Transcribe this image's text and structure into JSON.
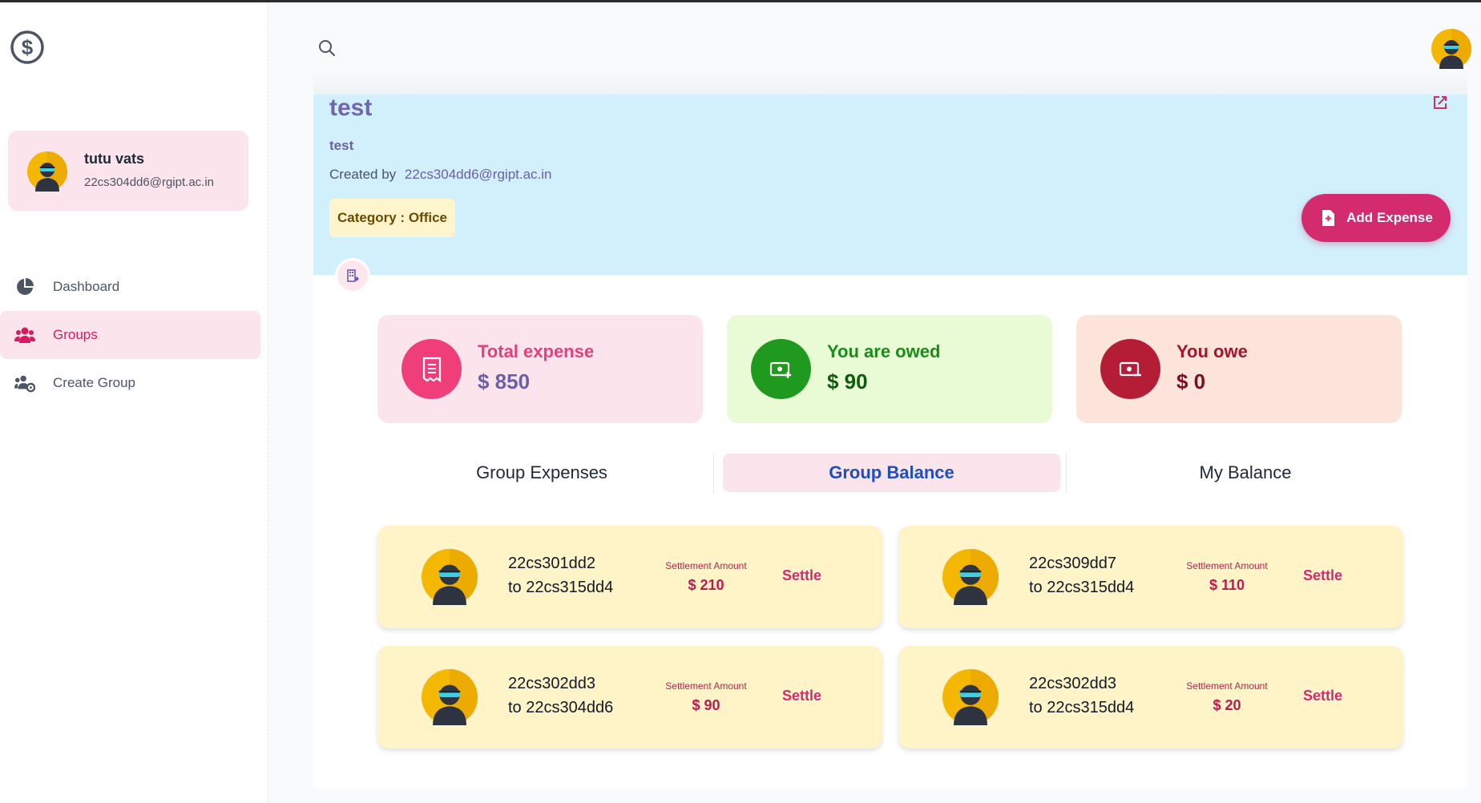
{
  "sidebar": {
    "logo_icon": "dollar-circle-icon",
    "user": {
      "name": "tutu vats",
      "email": "22cs304dd6@rgipt.ac.in"
    },
    "items": [
      {
        "label": "Dashboard",
        "icon": "pie-chart-icon"
      },
      {
        "label": "Groups",
        "icon": "users-icon"
      },
      {
        "label": "Create Group",
        "icon": "user-group-settings-icon"
      }
    ]
  },
  "header": {
    "search_icon": "search-icon"
  },
  "group": {
    "title": "test",
    "description": "test",
    "created_by_label": "Created by",
    "created_by_email": "22cs304dd6@rgipt.ac.in",
    "category_label": "Category :",
    "category_value": "Office",
    "add_expense_label": "Add Expense"
  },
  "stats": {
    "total": {
      "label": "Total expense",
      "value": "$ 850"
    },
    "owed": {
      "label": "You are owed",
      "value": "$ 90"
    },
    "owe": {
      "label": "You owe",
      "value": "$ 0"
    }
  },
  "tabs": [
    "Group Expenses",
    "Group Balance",
    "My Balance"
  ],
  "balances": [
    {
      "from": "22cs301dd2",
      "to": "to 22cs315dd4",
      "amount_label": "Settlement Amount",
      "amount": "$ 210",
      "action": "Settle"
    },
    {
      "from": "22cs309dd7",
      "to": "to 22cs315dd4",
      "amount_label": "Settlement Amount",
      "amount": "$ 110",
      "action": "Settle"
    },
    {
      "from": "22cs302dd3",
      "to": "to 22cs304dd6",
      "amount_label": "Settlement Amount",
      "amount": "$ 90",
      "action": "Settle"
    },
    {
      "from": "22cs302dd3",
      "to": "to 22cs315dd4",
      "amount_label": "Settlement Amount",
      "amount": "$ 20",
      "action": "Settle"
    }
  ],
  "colors": {
    "accent": "#d42b6f",
    "banner": "#d1f0fb",
    "active_tab_text": "#1e4fc2"
  }
}
